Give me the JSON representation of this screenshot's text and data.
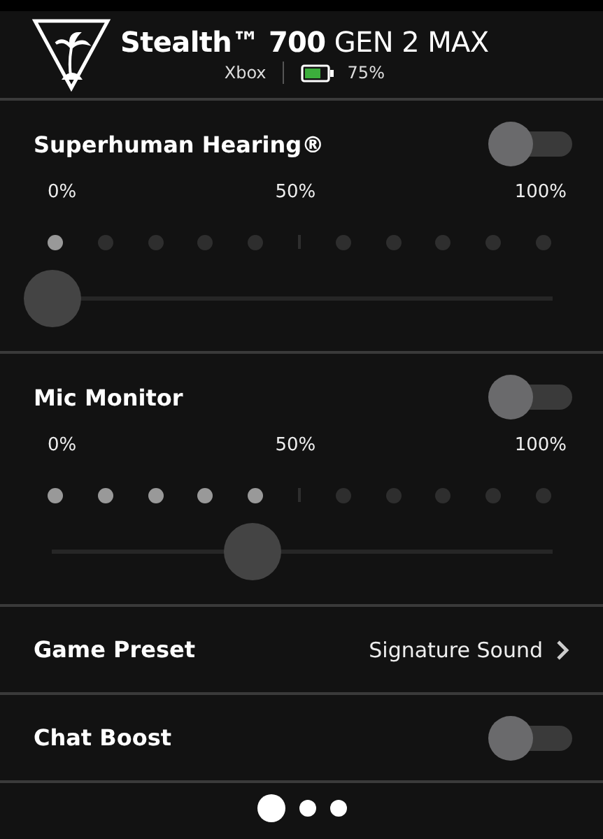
{
  "header": {
    "title": "**Stealth™ 700** GEN 2 MAX",
    "platform": "Xbox",
    "battery": {
      "reading": "75%"
    }
  },
  "sections": [
    {
      "kind": "slider",
      "title": "Superhuman Hearing®",
      "on": false,
      "ticks": [
        "0%",
        "50%",
        "100%"
      ],
      "level": 0
    },
    {
      "kind": "slider",
      "title": "Mic Monitor",
      "on": false,
      "ticks": [
        "0%",
        "50%",
        "100%"
      ],
      "level": 0.4
    },
    {
      "kind": "link",
      "title": "Game Preset",
      "value": "Signature Sound"
    },
    {
      "kind": "toggle",
      "title": "Chat Boost",
      "on": false
    }
  ],
  "pages": [
    {
      "selected": true
    },
    {
      "selected": false
    },
    {
      "selected": false
    }
  ]
}
